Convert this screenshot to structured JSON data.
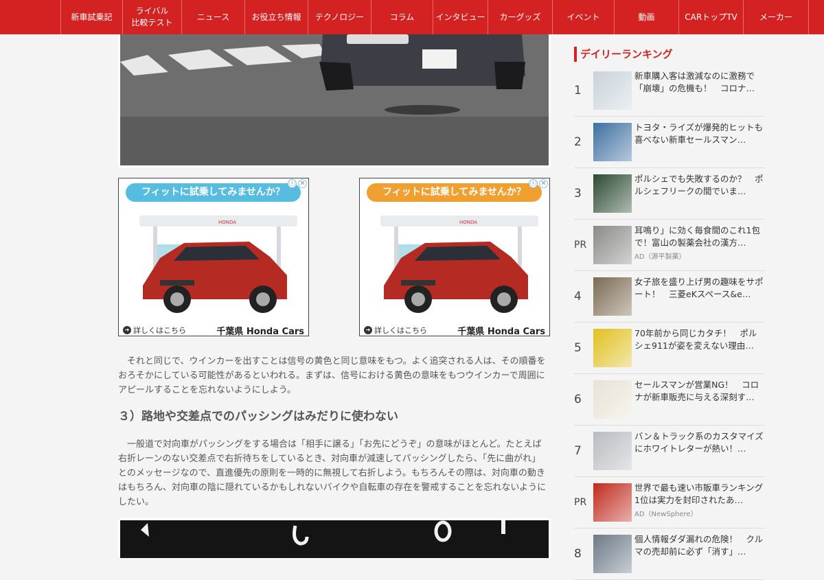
{
  "nav": [
    "新車試乗記",
    "ライバル\n比較テスト",
    "ニュース",
    "お役立ち情報",
    "テクノロジー",
    "コラム",
    "インタビュー",
    "カーグッズ",
    "イベント",
    "動画",
    "CARトップTV",
    "メーカー"
  ],
  "ads": [
    {
      "headline": "フィットに試乗してみませんか？",
      "more": "詳しくはこちら",
      "brand": "千葉県 Honda Cars",
      "store_sign": "HONDA",
      "banner_color": "#56bde0"
    },
    {
      "headline": "フィットに試乗してみませんか？",
      "more": "詳しくはこちら",
      "brand": "千葉県 Honda Cars",
      "store_sign": "HONDA",
      "banner_color": "#f0a030"
    }
  ],
  "article": {
    "paragraph1": "　それと同じで、ウインカーを出すことは信号の黄色と同じ意味をもつ。よく追突される人は、その順番をおろそかにしている可能性があるといわれる。まずは、信号における黄色の意味をもつウインカーで周囲にアピールすることを忘れないようにしよう。",
    "heading": "３）路地や交差点でのパッシングはみだりに使わない",
    "paragraph2": "　一般道で対向車がパッシングをする場合は「相手に譲る」「お先にどうぞ」の意味がほとんど。たとえば右折レーンのない交差点で右折待ちをしているとき、対向車が減速してパッシングしたら、「先に曲がれ」とのメッセージなので、直進優先の原則を一時的に無視して右折しよう。もちろんその際は、対向車の動きはもちろん、対向車の陰に隠れているかもしれないバイクや自転車の存在を警戒することを忘れないようにしたい。"
  },
  "ranking": {
    "title": "デイリーランキング",
    "items": [
      {
        "rank": "1",
        "text": "新車購入客は激減なのに激務で「崩壊」の危機も！　コロナ…",
        "ad": "",
        "thumb": "#c9d3da"
      },
      {
        "rank": "2",
        "text": "トヨタ・ライズが爆発的ヒットも喜べない新車セールスマン…",
        "ad": "",
        "thumb": "#3e6fa0"
      },
      {
        "rank": "3",
        "text": "ポルシェでも失敗するのか？　ポルシェフリークの間でいま…",
        "ad": "",
        "thumb": "#2c4a32"
      },
      {
        "rank": "PR",
        "text": "耳鳴り」に効く毎食間のこれ1包で！富山の製薬会社の漢方…",
        "ad": "AD（源平製薬）",
        "thumb": "#8a8a88"
      },
      {
        "rank": "4",
        "text": "女子旅を盛り上げ男の趣味をサポート！　三菱eKスペース&e…",
        "ad": "",
        "thumb": "#7a6a50"
      },
      {
        "rank": "5",
        "text": "70年前から同じカタチ！　ポルシェ911が姿を変えない理由…",
        "ad": "",
        "thumb": "#e0c020"
      },
      {
        "rank": "6",
        "text": "セールスマンが営業NG！　コロナが新車販売に与える深刻す…",
        "ad": "",
        "thumb": "#e8e2d4"
      },
      {
        "rank": "7",
        "text": "バン＆トラック系のカスタマイズにホワイトレターが熱い！…",
        "ad": "",
        "thumb": "#b8bcc0"
      },
      {
        "rank": "PR",
        "text": "世界で最も速い市販車ランキング 1位は実力を封印されたあ…",
        "ad": "AD（NewSphere）",
        "thumb": "#c02a1e"
      },
      {
        "rank": "8",
        "text": "個人情報ダダ漏れの危険！　クルマの売却前に必ず「消す」…",
        "ad": "",
        "thumb": "#6c7a88"
      }
    ]
  },
  "colors": {
    "nav_bg": "#d42222",
    "accent": "#d42222",
    "text": "#555555"
  }
}
